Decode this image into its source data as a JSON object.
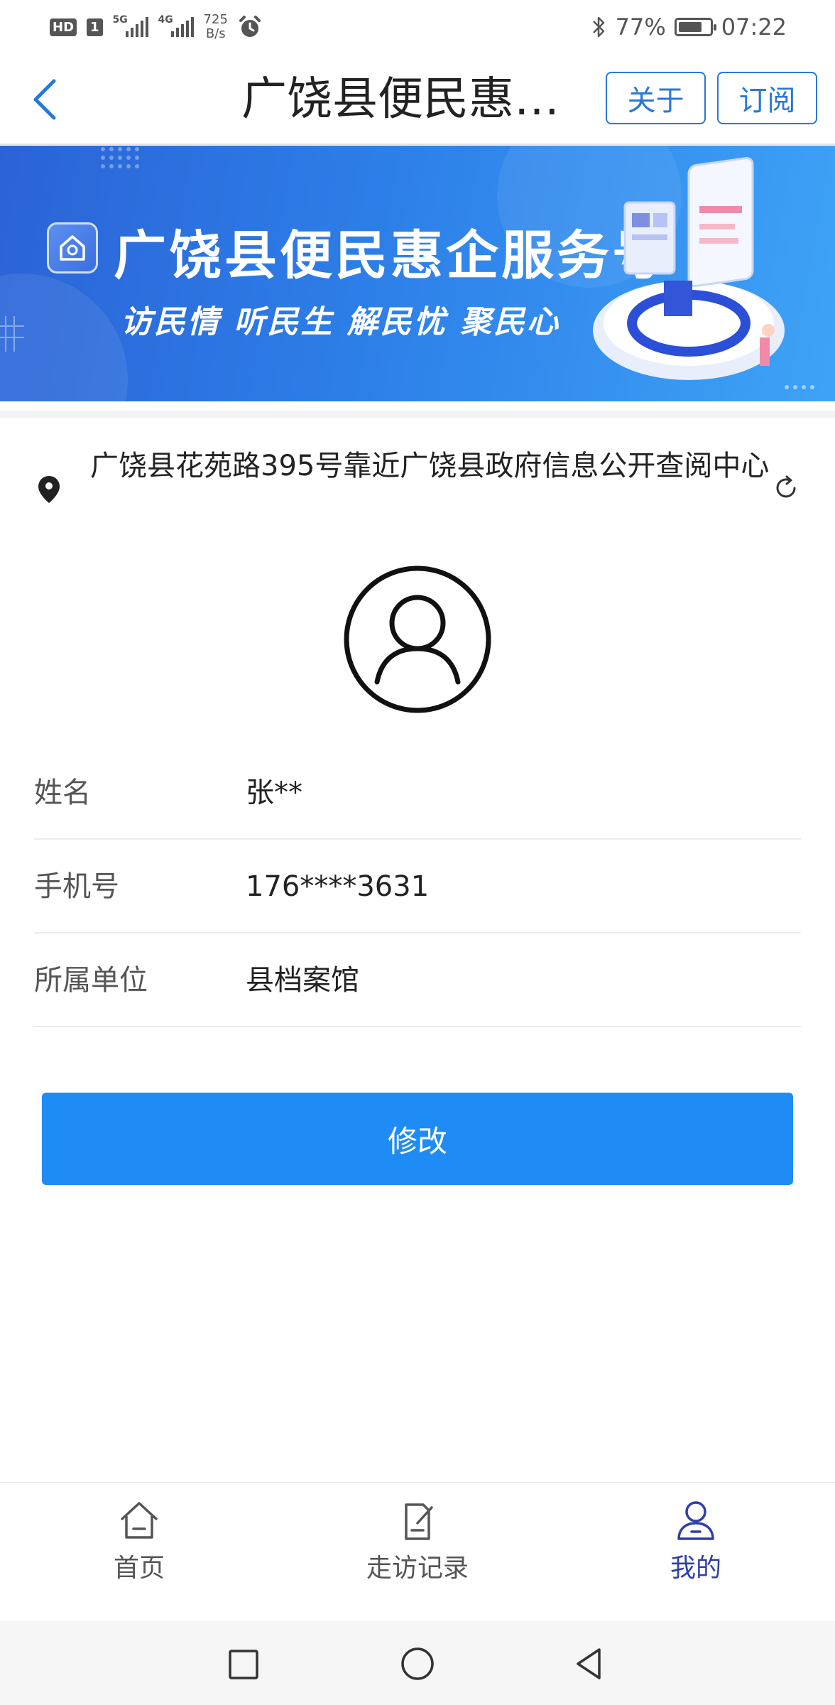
{
  "status_bar": {
    "hd": "HD",
    "sim": "1",
    "net1": "5G",
    "net2": "4G",
    "speed_value": "725",
    "speed_unit": "B/s",
    "battery_percent": "77%",
    "battery_level": 0.77,
    "time": "07:22"
  },
  "header": {
    "title": "广饶县便民惠企...",
    "about_label": "关于",
    "subscribe_label": "订阅"
  },
  "banner": {
    "title": "广饶县便民惠企服务号",
    "slogan": "访民情  听民生  解民忧  聚民心"
  },
  "location": {
    "address": "广饶县花苑路395号靠近广饶县政府信息公开查阅中心"
  },
  "profile": {
    "fields": [
      {
        "label": "姓名",
        "value": "张**"
      },
      {
        "label": "手机号",
        "value": "176****3631"
      },
      {
        "label": "所属单位",
        "value": "县档案馆"
      }
    ]
  },
  "actions": {
    "modify_label": "修改"
  },
  "tabbar": {
    "items": [
      {
        "label": "首页",
        "icon": "home-icon"
      },
      {
        "label": "走访记录",
        "icon": "visit-record-icon"
      },
      {
        "label": "我的",
        "icon": "profile-icon"
      }
    ],
    "active_index": 2
  },
  "colors": {
    "primary": "#1f8bf5",
    "header_accent": "#2a78d6",
    "tab_active": "#2f3fa8"
  }
}
